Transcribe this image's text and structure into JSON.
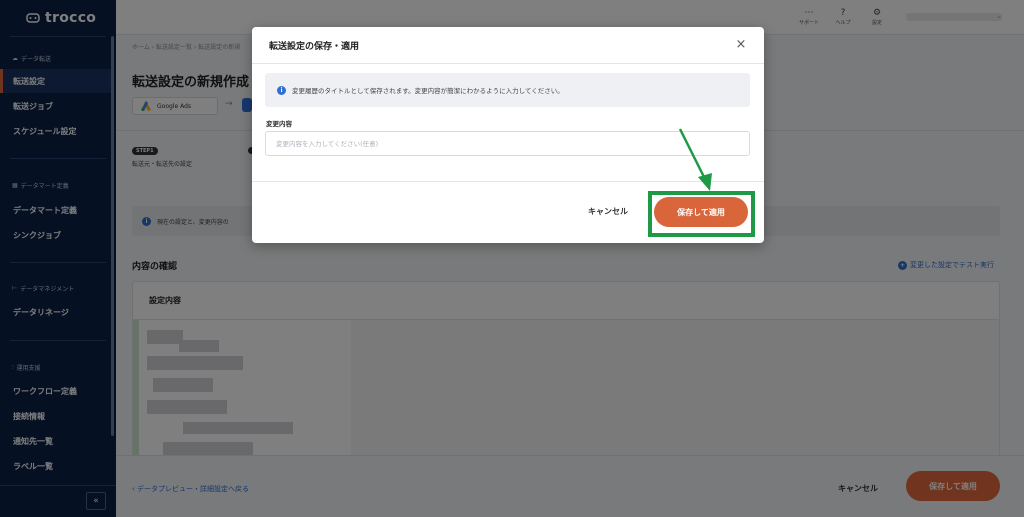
{
  "app": {
    "logo": "trocco"
  },
  "sidebar": {
    "sections": [
      {
        "label": "データ転送",
        "items": [
          "転送設定",
          "転送ジョブ",
          "スケジュール設定"
        ]
      },
      {
        "label": "データマート定義",
        "items": [
          "データマート定義",
          "シンクジョブ"
        ]
      },
      {
        "label": "データマネジメント",
        "items": [
          "データリネージ"
        ]
      },
      {
        "label": "運用支援",
        "items": [
          "ワークフロー定義",
          "接続情報",
          "通知先一覧",
          "ラベル一覧"
        ]
      }
    ],
    "active": "転送設定",
    "collapse_label": "«"
  },
  "header": {
    "icons": [
      {
        "glyph": "⋯",
        "label": "サポート"
      },
      {
        "glyph": "?",
        "label": "ヘルプ"
      },
      {
        "glyph": "⚙",
        "label": "設定"
      }
    ]
  },
  "main": {
    "breadcrumb": "ホーム › 転送設定一覧 › 転送設定の新規",
    "title": "転送設定の新規作成",
    "source": "Google Ads",
    "step_badge": "STEP1",
    "step_text": "転送元・転送先の設定",
    "info_text": "現在の設定と、変更内容の",
    "section_title": "内容の確認",
    "test_link": "変更した設定でテスト実行",
    "card_title": "設定内容",
    "back_link": "‹ データプレビュー・詳細設定へ戻る",
    "cancel": "キャンセル",
    "save": "保存して適用"
  },
  "modal": {
    "title": "転送設定の保存・適用",
    "close": "×",
    "info": "変更履歴のタイトルとして保存されます。変更内容が簡潔にわかるように入力してください。",
    "field_label": "変更内容",
    "field_value": "",
    "field_placeholder": "変更内容を入力してください(任意)",
    "cancel": "キャンセル",
    "save": "保存して適用"
  },
  "colors": {
    "brand_navy": "#0b2147",
    "accent": "#e2683c",
    "annotation": "#1e9a46",
    "link": "#2f6fd6"
  }
}
